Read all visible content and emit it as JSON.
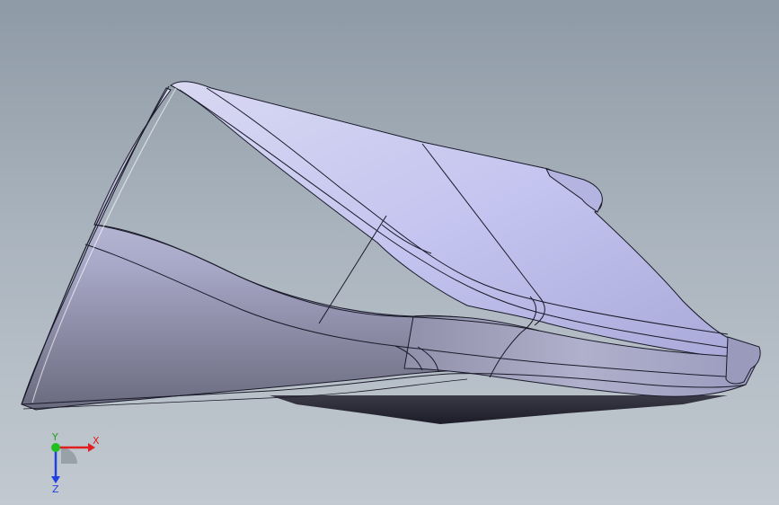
{
  "viewport": {
    "background_top": "#8e9aa6",
    "background_bottom": "#c2c9d0"
  },
  "model": {
    "face_color": "#c8c8ee",
    "edge_color": "#1a1a2a",
    "shadow_color": "#2a2a3a"
  },
  "triad": {
    "x_label": "X",
    "y_label": "Y",
    "z_label": "Z",
    "x_color": "#e02020",
    "y_color": "#20c020",
    "z_color": "#2040e0"
  }
}
